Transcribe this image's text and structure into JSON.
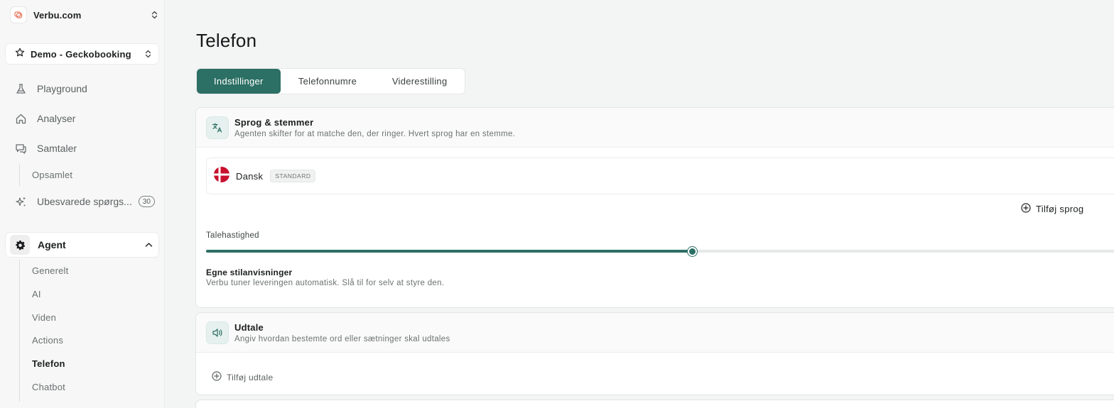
{
  "sidebar": {
    "org": {
      "name": "Verbu.com",
      "logo_color": "#e8735a"
    },
    "project": {
      "name": "Demo - Geckobooking"
    },
    "nav": [
      {
        "label": "Playground",
        "icon": "flask-icon"
      },
      {
        "label": "Analyser",
        "icon": "home-icon"
      },
      {
        "label": "Samtaler",
        "icon": "chat-icon"
      }
    ],
    "conversation_sub": [
      {
        "label": "Opsamlet"
      }
    ],
    "unanswered": {
      "label": "Ubesvarede spørgs...",
      "count": "30",
      "icon": "sparkles-icon"
    },
    "agent": {
      "label": "Agent",
      "icon": "gear-icon"
    },
    "agent_sub": [
      {
        "label": "Generelt"
      },
      {
        "label": "AI"
      },
      {
        "label": "Viden"
      },
      {
        "label": "Actions"
      },
      {
        "label": "Telefon",
        "active": true
      },
      {
        "label": "Chatbot"
      }
    ]
  },
  "main": {
    "title": "Telefon",
    "tabs": [
      {
        "label": "Indstillinger",
        "active": true
      },
      {
        "label": "Telefonnumre"
      },
      {
        "label": "Viderestilling"
      }
    ],
    "languages_card": {
      "title": "Sprog & stemmer",
      "subtitle": "Agenten skifter for at matche den, der ringer. Hvert sprog har en stemme.",
      "languages": [
        {
          "name": "Dansk",
          "badge": "STANDARD",
          "flag": "denmark-flag-icon"
        }
      ],
      "add_language": "Tilføj sprog",
      "speed_label": "Talehastighed",
      "speed_value": 0.528,
      "style_title": "Egne stilanvisninger",
      "style_subtitle": "Verbu tuner leveringen automatisk. Slå til for selv at styre den."
    },
    "pronunciation_card": {
      "title": "Udtale",
      "subtitle": "Angiv hvordan bestemte ord eller sætninger skal udtales",
      "add_label": "Tilføj udtale"
    }
  },
  "colors": {
    "accent": "#2c6f64",
    "flag_red": "#c8102e"
  }
}
